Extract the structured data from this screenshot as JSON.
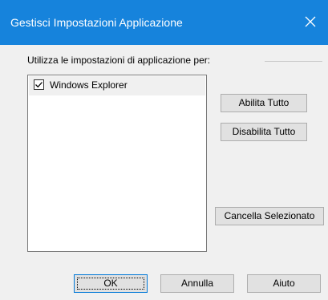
{
  "window": {
    "title": "Gestisci Impostazioni Applicazione",
    "titlebar_color": "#1683dc"
  },
  "group": {
    "label": "Utilizza le impostazioni di applicazione per:"
  },
  "list": {
    "items": [
      {
        "label": "Windows Explorer",
        "checked": true
      }
    ]
  },
  "buttons": {
    "enable_all": "Abilita Tutto",
    "disable_all": "Disabilita Tutto",
    "clear_selected": "Cancella Selezionato",
    "ok": "OK",
    "cancel": "Annulla",
    "help": "Aiuto"
  },
  "icons": {
    "close": "close-icon",
    "check": "checkmark-icon"
  }
}
